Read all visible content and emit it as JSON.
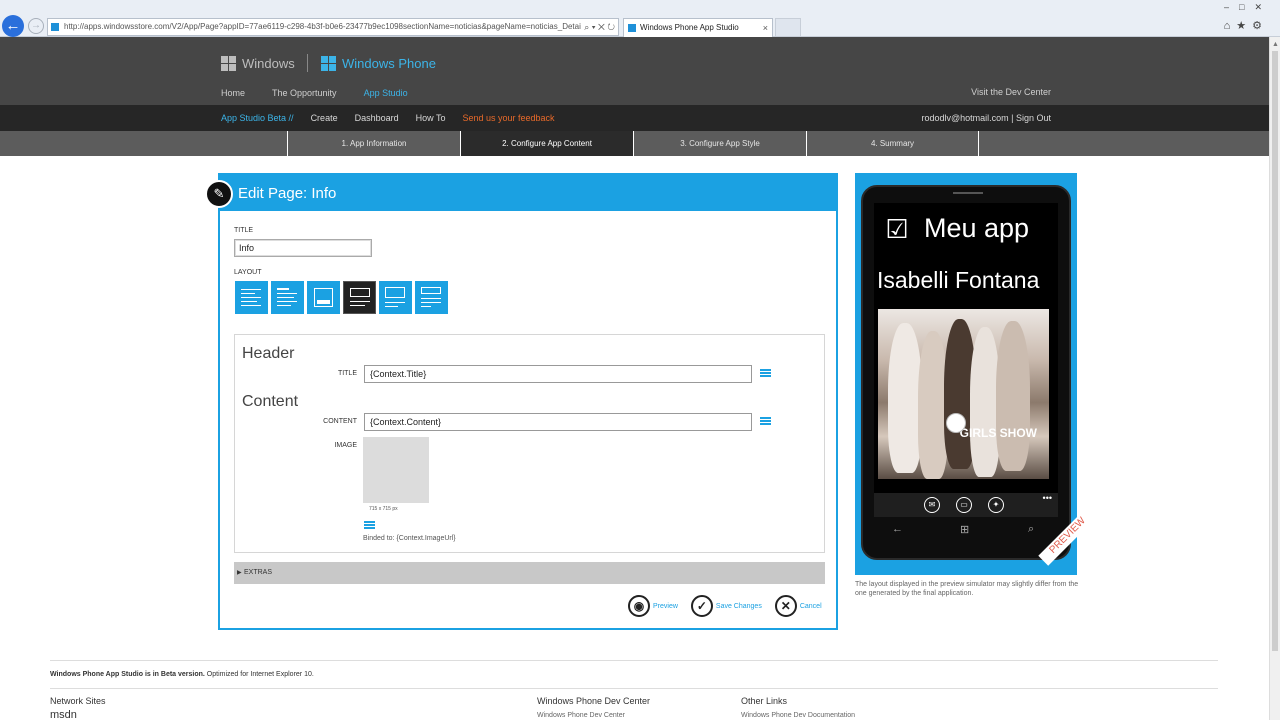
{
  "browser": {
    "address": "http://apps.windowsstore.com/V2/App/Page?appID=77ae6119-c298-4b3f-b0e6-23477b9ec1098sectionName=noticias&pageName=noticias_Detail",
    "address_controls": "⌕ ▾ ✕ ↻",
    "tab_title": "Windows Phone App Studio",
    "tab_close": "×",
    "window_controls": "–□✕",
    "tool_icons": "⌂★⚙"
  },
  "header": {
    "windows_label": "Windows",
    "windows_phone_label": "Windows Phone",
    "nav": [
      "Home",
      "The Opportunity",
      "App Studio"
    ],
    "dev_center_link": "Visit the Dev Center",
    "colors": {
      "accent": "#1ba1e2",
      "feedback": "#e86a2a",
      "dark": "#262626"
    }
  },
  "subnav": {
    "beta": "App Studio Beta //",
    "items": [
      "Create",
      "Dashboard",
      "How To"
    ],
    "feedback": "Send us your feedback",
    "account": "rododlv@hotmail.com | Sign Out"
  },
  "steps": [
    "1. App Information",
    "2. Configure App Content",
    "3. Configure App Style",
    "4. Summary"
  ],
  "editor": {
    "title": "Edit Page: Info",
    "title_label": "TITLE",
    "title_value": "Info",
    "layout_label": "LAYOUT",
    "header_section": "Header",
    "header_title_label": "TITLE",
    "header_title_value": "{Context.Title}",
    "content_section": "Content",
    "content_label": "CONTENT",
    "content_value": "{Context.Content}",
    "image_label": "IMAGE",
    "image_size": "715 x 715 px",
    "binded": "Binded to: {Context.ImageUrl}",
    "extras": "EXTRAS",
    "preview": "Preview",
    "save": "Save Changes",
    "cancel": "Cancel"
  },
  "phone": {
    "app_title": "Meu app",
    "page_heading": "Isabelli Fontana",
    "photo_text": "GIRLS SHOW",
    "appbar_dots": "•••",
    "ribbon": "PREVIEW",
    "disclaimer": "The layout displayed in the preview simulator may slightly differ from the one generated by the final application."
  },
  "footer": {
    "beta_bold": "Windows Phone App Studio is in Beta version.",
    "beta_rest": " Optimized for Internet Explorer 10.",
    "col1": "Network Sites",
    "col1_item": "msdn",
    "col2": "Windows Phone Dev Center",
    "col2_item": "Windows Phone Dev Center",
    "col3": "Other Links",
    "col3_item": "Windows Phone Dev Documentation"
  }
}
